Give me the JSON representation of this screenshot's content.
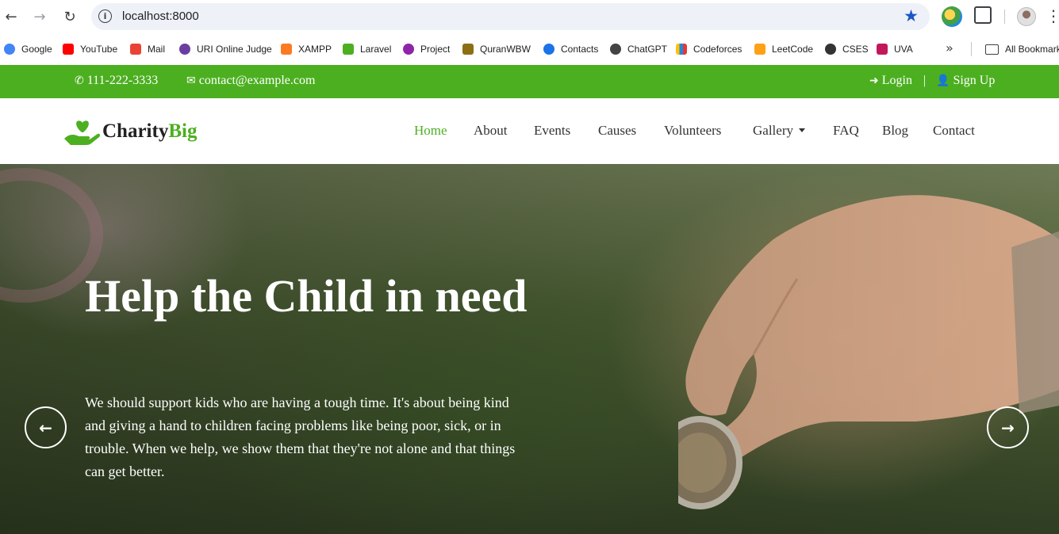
{
  "browser": {
    "url": "localhost:8000",
    "bookmarks": [
      {
        "label": "Google",
        "color": "#4285f4"
      },
      {
        "label": "YouTube",
        "color": "#ff0000"
      },
      {
        "label": "Mail",
        "color": "#ea4335"
      },
      {
        "label": "URI Online Judge",
        "color": "#6a3ea1"
      },
      {
        "label": "XAMPP",
        "color": "#fb7a24"
      },
      {
        "label": "Laravel",
        "color": "#4caf20"
      },
      {
        "label": "Project",
        "color": "#8e24aa"
      },
      {
        "label": "QuranWBW",
        "color": "#8d6e15"
      },
      {
        "label": "Contacts",
        "color": "#1a73e8"
      },
      {
        "label": "ChatGPT",
        "color": "#444444"
      },
      {
        "label": "Codeforces",
        "color": "#1e88e5"
      },
      {
        "label": "LeetCode",
        "color": "#ffa116"
      },
      {
        "label": "CSES",
        "color": "#333333"
      },
      {
        "label": "UVA",
        "color": "#c2185b"
      }
    ],
    "all_bookmarks": "All Bookmarks"
  },
  "topbar": {
    "phone": "111-222-3333",
    "email": "contact@example.com",
    "login": "Login",
    "separator": "|",
    "signup": "Sign Up"
  },
  "brand": {
    "name_main": "Charity",
    "name_accent": "Big",
    "accent_color": "#4caf20"
  },
  "nav": {
    "home": "Home",
    "about": "About",
    "events": "Events",
    "causes": "Causes",
    "volunteers": "Volunteers",
    "gallery": "Gallery",
    "faq": "FAQ",
    "blog": "Blog",
    "contact": "Contact"
  },
  "hero": {
    "title": "Help the Child in need",
    "text": "We should support kids who are having a tough time. It's about being kind and giving a hand to children facing problems like being poor, sick, or in trouble. When we help, we show them that they're not alone and that things can get better."
  }
}
